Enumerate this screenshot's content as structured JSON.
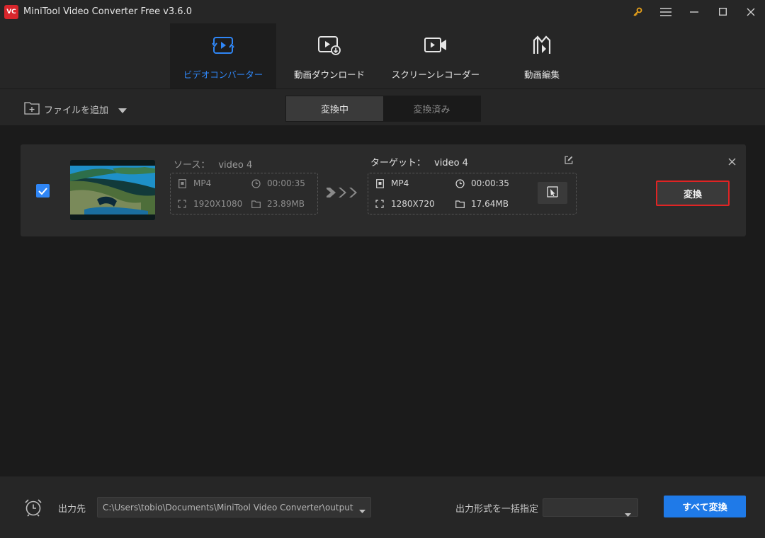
{
  "app": {
    "logo_text": "VC",
    "title": "MiniTool Video Converter Free v3.6.0"
  },
  "window_controls": [
    "key-icon",
    "menu-icon",
    "minimize-icon",
    "maximize-icon",
    "close-icon"
  ],
  "nav": {
    "tabs": [
      {
        "label": "ビデオコンバーター",
        "icon": "video-convert-icon",
        "active": true
      },
      {
        "label": "動画ダウンロード",
        "icon": "video-download-icon",
        "active": false
      },
      {
        "label": "スクリーンレコーダー",
        "icon": "screen-record-icon",
        "active": false
      },
      {
        "label": "動画編集",
        "icon": "video-edit-icon",
        "active": false
      }
    ]
  },
  "toolbar": {
    "add_file_label": "ファイルを追加",
    "segments": [
      {
        "label": "変換中",
        "active": true
      },
      {
        "label": "変換済み",
        "active": false
      }
    ]
  },
  "task": {
    "checked": true,
    "source": {
      "label": "ソース：",
      "name": "video 4",
      "format": "MP4",
      "duration": "00:00:35",
      "resolution": "1920X1080",
      "size": "23.89MB"
    },
    "target": {
      "label": "ターゲット：",
      "name": "video 4",
      "format": "MP4",
      "duration": "00:00:35",
      "resolution": "1280X720",
      "size": "17.64MB"
    },
    "convert_label": "変換"
  },
  "footer": {
    "output_label": "出力先",
    "output_path": "C:\\Users\\tobio\\Documents\\MiniTool Video Converter\\output",
    "format_label": "出力形式を一括指定",
    "format_value": "",
    "convert_all_label": "すべて変換"
  },
  "colors": {
    "accent": "#2f86f6",
    "highlight_border": "#e02424",
    "brand_red": "#d8262c",
    "key_icon": "#e8a11a"
  }
}
